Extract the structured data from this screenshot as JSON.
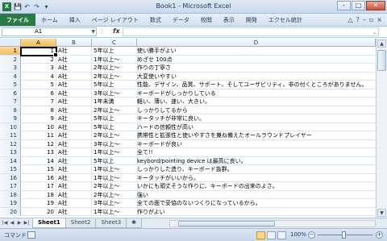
{
  "window": {
    "title": "Book1 - Microsoft Excel"
  },
  "qat": {
    "save": "💾",
    "undo": "↶",
    "redo": "↷",
    "customize": "▾"
  },
  "ribbon": {
    "tabs": [
      "ファイル",
      "ホーム",
      "挿入",
      "ページ レイアウト",
      "数式",
      "データ",
      "校閲",
      "表示",
      "開発",
      "エクセル統計"
    ]
  },
  "formula": {
    "namebox": "A1",
    "fx": "fx",
    "value": ""
  },
  "columns": [
    "A",
    "B",
    "C",
    "D"
  ],
  "rows": [
    {
      "num": "1",
      "a": "1",
      "b": "A社",
      "c": "5年以上",
      "d": "使い勝手がよい"
    },
    {
      "num": "2",
      "a": "2",
      "b": "A社",
      "c": "1年以上～",
      "d": "めざせ 100点"
    },
    {
      "num": "3",
      "a": "3",
      "b": "A社",
      "c": "2年以上～",
      "d": "作りの丁寧さ"
    },
    {
      "num": "4",
      "a": "4",
      "b": "A社",
      "c": "2年以上～",
      "d": "大変使いやすい"
    },
    {
      "num": "5",
      "a": "5",
      "b": "A社",
      "c": "5年以上",
      "d": "性能、デザイン、品質、サポート、そしてユーザビリティ、非の付くところがありません。"
    },
    {
      "num": "6",
      "a": "6",
      "b": "A社",
      "c": "3年以上～",
      "d": "キーボードがしっかりしている"
    },
    {
      "num": "7",
      "a": "7",
      "b": "A社",
      "c": "1年未満",
      "d": "軽い、薄い、速い、大きい。"
    },
    {
      "num": "8",
      "a": "8",
      "b": "A社",
      "c": "2年以上～",
      "d": "しっかりしてるから"
    },
    {
      "num": "9",
      "a": "9",
      "b": "A社",
      "c": "5年以上",
      "d": "キータッチが非常に良い。"
    },
    {
      "num": "10",
      "a": "10",
      "b": "A社",
      "c": "5年以上",
      "d": "ハードの信頼性が高い"
    },
    {
      "num": "11",
      "a": "11",
      "b": "A社",
      "c": "2年以上～",
      "d": "携帯性と拡張性と使いやすさを兼ね備えたオールラウンドプレイヤー"
    },
    {
      "num": "12",
      "a": "12",
      "b": "A社",
      "c": "3年以上～",
      "d": "キーボードが良い"
    },
    {
      "num": "13",
      "a": "13",
      "b": "A社",
      "c": "1年以上～",
      "d": "全て!!"
    },
    {
      "num": "14",
      "a": "14",
      "b": "A社",
      "c": "5年以上",
      "d": "keybord/pointing device は最高に良い。"
    },
    {
      "num": "15",
      "a": "15",
      "b": "A社",
      "c": "1年以上～",
      "d": "しっかりした造り、キーボード抜群。"
    },
    {
      "num": "16",
      "a": "16",
      "b": "A社",
      "c": "1年以上～",
      "d": "キータッチがいいから。"
    },
    {
      "num": "17",
      "a": "17",
      "b": "A社",
      "c": "2年以上～",
      "d": "いかにも頑丈そうな作りに、キーボードの出来のよさ。"
    },
    {
      "num": "18",
      "a": "18",
      "b": "A社",
      "c": "2年以上～",
      "d": "強い"
    },
    {
      "num": "19",
      "a": "19",
      "b": "A社",
      "c": "3年以上～",
      "d": "全ての面で妥協のないつくりになっているから。"
    },
    {
      "num": "20",
      "a": "20",
      "b": "A社",
      "c": "1年以上～",
      "d": "作りがよい"
    }
  ],
  "sheets": [
    "Sheet1",
    "Sheet2",
    "Sheet3"
  ],
  "status": {
    "ready": "コマンド",
    "zoom": "100%"
  }
}
